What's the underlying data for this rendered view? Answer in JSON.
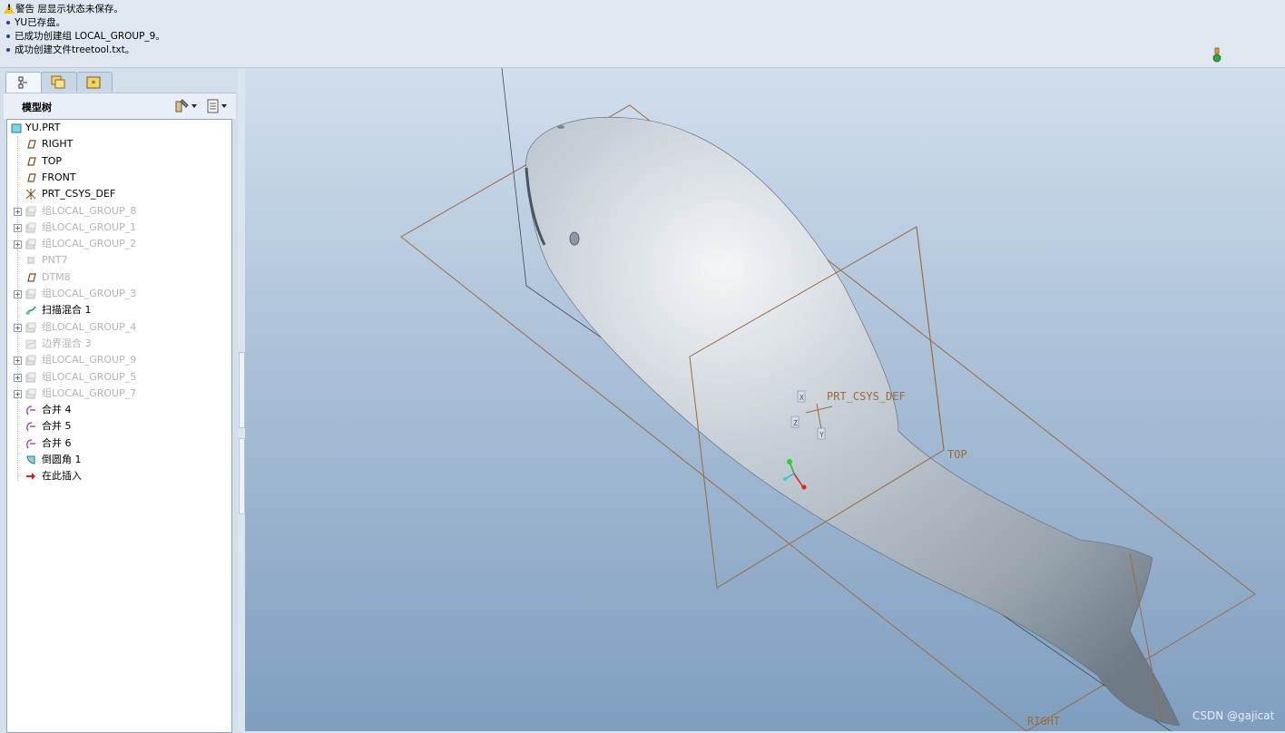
{
  "messages": [
    {
      "type": "warning",
      "text": "警告 层显示状态未保存。"
    },
    {
      "type": "info",
      "text": "YU已存盘。"
    },
    {
      "type": "info",
      "text": "已成功创建组 LOCAL_GROUP_9。"
    },
    {
      "type": "info",
      "text": "成功创建文件treetool.txt。"
    }
  ],
  "tabs": [
    {
      "icon": "model-tree-tab-icon",
      "active": true
    },
    {
      "icon": "folder-browser-tab-icon",
      "active": false
    },
    {
      "icon": "favorites-tab-icon",
      "active": false
    }
  ],
  "tree": {
    "title": "模型树",
    "items": [
      {
        "label": "YU.PRT",
        "icon": "part-icon",
        "dim": false,
        "expandable": false,
        "root": true
      },
      {
        "label": "RIGHT",
        "icon": "datum-plane-icon",
        "dim": false,
        "expandable": false
      },
      {
        "label": "TOP",
        "icon": "datum-plane-icon",
        "dim": false,
        "expandable": false
      },
      {
        "label": "FRONT",
        "icon": "datum-plane-icon",
        "dim": false,
        "expandable": false
      },
      {
        "label": "PRT_CSYS_DEF",
        "icon": "csys-icon",
        "dim": false,
        "expandable": false
      },
      {
        "label": "组LOCAL_GROUP_8",
        "icon": "group-icon",
        "dim": true,
        "expandable": true
      },
      {
        "label": "组LOCAL_GROUP_1",
        "icon": "group-icon",
        "dim": true,
        "expandable": true
      },
      {
        "label": "组LOCAL_GROUP_2",
        "icon": "group-icon",
        "dim": true,
        "expandable": true
      },
      {
        "label": "PNT7",
        "icon": "datum-point-icon",
        "dim": true,
        "expandable": false
      },
      {
        "label": "DTM8",
        "icon": "datum-plane-icon",
        "dim": true,
        "expandable": false
      },
      {
        "label": "组LOCAL_GROUP_3",
        "icon": "group-icon",
        "dim": true,
        "expandable": true
      },
      {
        "label": "扫描混合 1",
        "icon": "swept-blend-icon",
        "dim": false,
        "expandable": false
      },
      {
        "label": "组LOCAL_GROUP_4",
        "icon": "group-icon",
        "dim": true,
        "expandable": true
      },
      {
        "label": "边界混合 3",
        "icon": "boundary-blend-icon",
        "dim": true,
        "expandable": false
      },
      {
        "label": "组LOCAL_GROUP_9",
        "icon": "group-icon",
        "dim": true,
        "expandable": true
      },
      {
        "label": "组LOCAL_GROUP_5",
        "icon": "group-icon",
        "dim": true,
        "expandable": true
      },
      {
        "label": "组LOCAL_GROUP_7",
        "icon": "group-icon",
        "dim": true,
        "expandable": true
      },
      {
        "label": "合并 4",
        "icon": "merge-icon",
        "dim": false,
        "expandable": false
      },
      {
        "label": "合并 5",
        "icon": "merge-icon",
        "dim": false,
        "expandable": false
      },
      {
        "label": "合并 6",
        "icon": "merge-icon",
        "dim": false,
        "expandable": false
      },
      {
        "label": "倒圆角 1",
        "icon": "round-icon",
        "dim": false,
        "expandable": false
      },
      {
        "label": "在此插入",
        "icon": "insert-here-arrow-icon",
        "dim": false,
        "expandable": false
      }
    ]
  },
  "viewport": {
    "labels": {
      "csys": "PRT_CSYS_DEF",
      "top": "TOP",
      "right": "RIGHT",
      "x": "X",
      "y": "Y",
      "z": "Z"
    },
    "colors": {
      "datum": "#9b6a3c",
      "model": "#b9c1c9"
    }
  },
  "watermark": "CSDN @gajicat"
}
